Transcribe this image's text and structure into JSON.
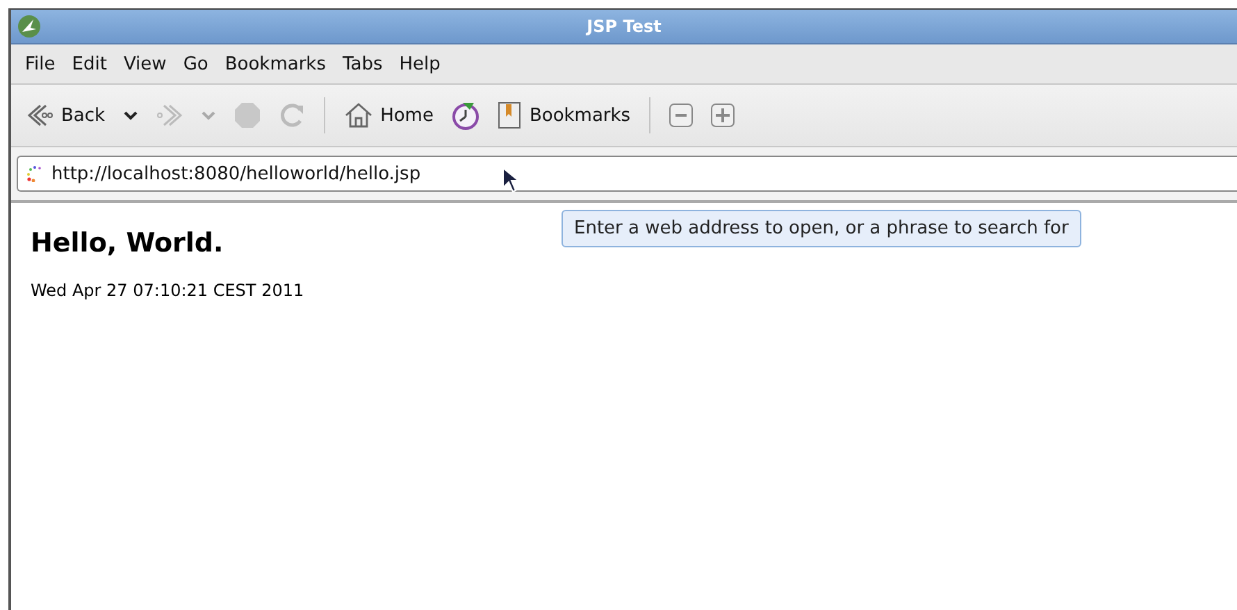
{
  "window": {
    "title": "JSP Test"
  },
  "menu": [
    "File",
    "Edit",
    "View",
    "Go",
    "Bookmarks",
    "Tabs",
    "Help"
  ],
  "toolbar": [
    {
      "kind": "back",
      "label": "Back",
      "disabled": false
    },
    {
      "kind": "dropdown",
      "disabled": false
    },
    {
      "kind": "forward",
      "disabled": true
    },
    {
      "kind": "dropdown",
      "disabled": true
    },
    {
      "kind": "stop",
      "disabled": true
    },
    {
      "kind": "reload",
      "disabled": true
    },
    {
      "kind": "separator"
    },
    {
      "kind": "home",
      "label": "Home",
      "disabled": false
    },
    {
      "kind": "history"
    },
    {
      "kind": "bookmarks",
      "label": "Bookmarks",
      "disabled": false
    },
    {
      "kind": "separator"
    },
    {
      "kind": "zoom-out"
    },
    {
      "kind": "zoom-in"
    }
  ],
  "address": {
    "value": "http://localhost:8080/helloworld/hello.jsp"
  },
  "tooltip": "Enter a web address to open, or a phrase to search for",
  "page": {
    "heading": "Hello, World.",
    "date": "Wed Apr 27 07:10:21 CEST 2011"
  }
}
